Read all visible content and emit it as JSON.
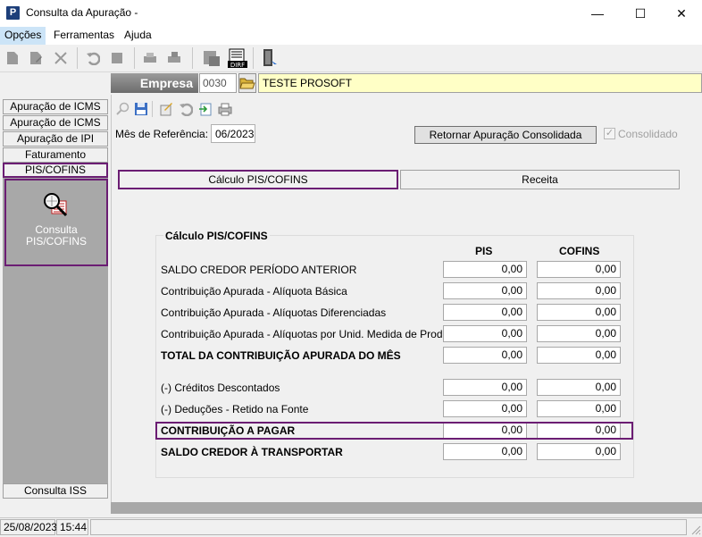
{
  "window": {
    "title": "Consulta da Apuração -",
    "minimize": "—",
    "maximize": "☐",
    "close": "✕",
    "app_icon": "P"
  },
  "menu": [
    {
      "id": "opcoes",
      "label": "Opções"
    },
    {
      "id": "ferramentas",
      "label": "Ferramentas"
    },
    {
      "id": "ajuda",
      "label": "Ajuda"
    }
  ],
  "toolbar_icons": [
    "new-icon",
    "edit-icon",
    "delete-icon",
    "undo-icon",
    "stop-icon",
    "print-icon",
    "print-preview-icon",
    "calculator-icon",
    "dirf-icon",
    "exit-door-icon"
  ],
  "empresa": {
    "label": "Empresa",
    "code": "0030",
    "name": "TESTE PROSOFT"
  },
  "nav": {
    "items": [
      "Apuração de ICMS",
      "Apuração de ICMS ST",
      "Apuração de IPI",
      "Faturamento",
      "PIS/COFINS"
    ],
    "active": "PIS/COFINS",
    "consulta_label": "Consulta PIS/COFINS",
    "bottom_item": "Consulta ISS"
  },
  "form": {
    "mes_label": "Mês de Referência:",
    "mes_value": "06/2023",
    "retornar_label": "Retornar Apuração Consolidada",
    "consolidado_label": "Consolidado",
    "consolidado_checked": true
  },
  "tabs": [
    {
      "label": "Cálculo PIS/COFINS",
      "active": true
    },
    {
      "label": "Receita",
      "active": false
    }
  ],
  "calc": {
    "title": "Cálculo PIS/COFINS",
    "col_pis": "PIS",
    "col_cofins": "COFINS",
    "rows": [
      {
        "label": "SALDO CREDOR PERÍODO ANTERIOR",
        "pis": "0,00",
        "cofins": "0,00"
      },
      {
        "label": "Contribuição Apurada - Alíquota Básica",
        "pis": "0,00",
        "cofins": "0,00"
      },
      {
        "label": "Contribuição Apurada - Alíquotas Diferenciadas",
        "pis": "0,00",
        "cofins": "0,00"
      },
      {
        "label": "Contribuição Apurada - Alíquotas por Unid. Medida de Produto",
        "pis": "0,00",
        "cofins": "0,00"
      },
      {
        "label": "TOTAL DA CONTRIBUIÇÃO APURADA DO MÊS",
        "pis": "0,00",
        "cofins": "0,00"
      },
      {
        "label": "(-) Créditos Descontados",
        "pis": "0,00",
        "cofins": "0,00"
      },
      {
        "label": "(-) Deduções - Retido na Fonte",
        "pis": "0,00",
        "cofins": "0,00"
      },
      {
        "label": "CONTRIBUIÇÃO A PAGAR",
        "pis": "0,00",
        "cofins": "0,00"
      },
      {
        "label": "SALDO CREDOR À TRANSPORTAR",
        "pis": "0,00",
        "cofins": "0,00"
      }
    ]
  },
  "status": {
    "date": "25/08/2023",
    "time": "15:44"
  },
  "colors": {
    "highlight": "#6b1d73",
    "empresa_name_bg": "#ffffc6",
    "nav_body": "#a8a8a8"
  }
}
